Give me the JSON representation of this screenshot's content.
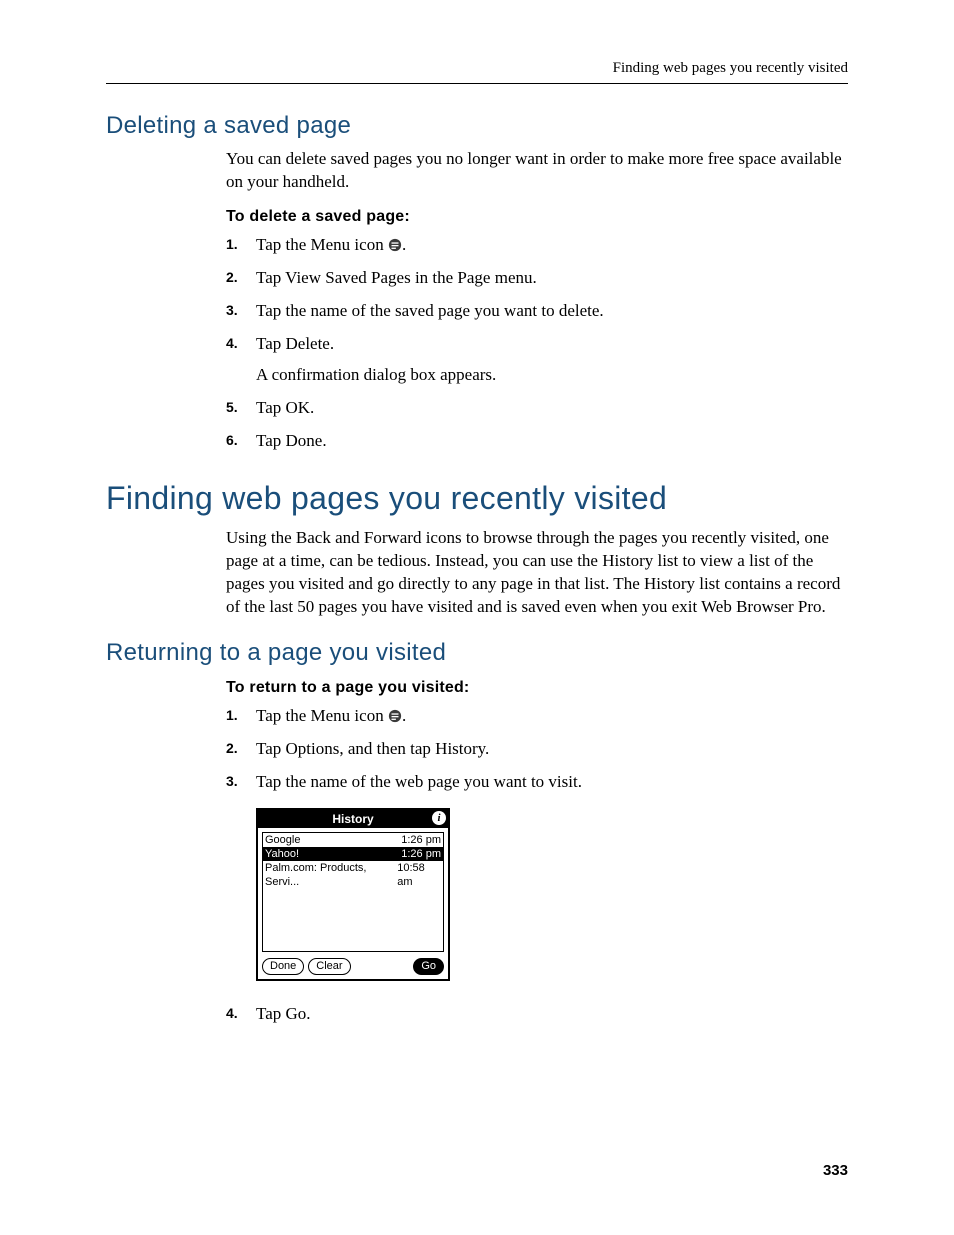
{
  "header": {
    "running": "Finding web pages you recently visited"
  },
  "section_delete": {
    "title": "Deleting a saved page",
    "intro": "You can delete saved pages you no longer want in order to make more free space available on your handheld.",
    "procedure_label": "To delete a saved page:",
    "steps": {
      "s1a": "Tap the Menu icon ",
      "s1b": ".",
      "s2": "Tap View Saved Pages in the Page menu.",
      "s3": "Tap the name of the saved page you want to delete.",
      "s4": "Tap Delete.",
      "s4_sub": "A confirmation dialog box appears.",
      "s5": "Tap OK.",
      "s6": "Tap Done."
    }
  },
  "section_finding": {
    "title": "Finding web pages you recently visited",
    "intro": "Using the Back and Forward icons to browse through the pages you recently visited, one page at a time, can be tedious. Instead, you can use the History list to view a list of the pages you visited and go directly to any page in that list. The History list contains a record of the last 50 pages you have visited and is saved even when you exit Web Browser Pro."
  },
  "section_return": {
    "title": "Returning to a page you visited",
    "procedure_label": "To return to a page you visited:",
    "steps": {
      "s1a": "Tap the Menu icon ",
      "s1b": ".",
      "s2": "Tap Options, and then tap History.",
      "s3": "Tap the name of the web page you want to visit.",
      "s4": "Tap Go."
    }
  },
  "history_dialog": {
    "title": "History",
    "info_glyph": "i",
    "rows": [
      {
        "name": "Google",
        "time": "1:26 pm",
        "selected": false
      },
      {
        "name": "Yahoo!",
        "time": "1:26 pm",
        "selected": true
      },
      {
        "name": "Palm.com: Products, Servi...",
        "time": "10:58 am",
        "selected": false
      }
    ],
    "buttons": {
      "done": "Done",
      "clear": "Clear",
      "go": "Go"
    }
  },
  "page_number": "333"
}
